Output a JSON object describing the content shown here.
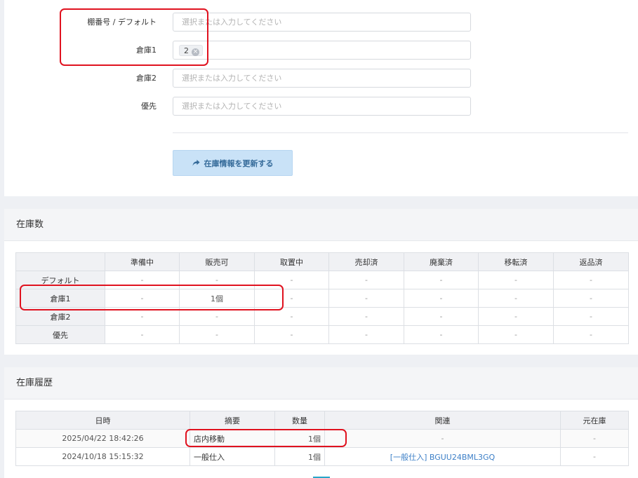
{
  "form": {
    "fields": [
      {
        "label": "棚番号 / デフォルト",
        "placeholder": "選択または入力してください"
      },
      {
        "label": "倉庫1",
        "tag": "2"
      },
      {
        "label": "倉庫2",
        "placeholder": "選択または入力してください"
      },
      {
        "label": "優先",
        "placeholder": "選択または入力してください"
      }
    ],
    "update_button": "在庫情報を更新する",
    "update_icon": "share-arrow-icon"
  },
  "stock": {
    "title": "在庫数",
    "columns": [
      "",
      "準備中",
      "販売可",
      "取置中",
      "売却済",
      "廃棄済",
      "移転済",
      "返品済"
    ],
    "rows": [
      {
        "label": "デフォルト",
        "cells": [
          "-",
          "-",
          "-",
          "-",
          "-",
          "-",
          "-"
        ]
      },
      {
        "label": "倉庫1",
        "cells": [
          "-",
          "1個",
          "-",
          "-",
          "-",
          "-",
          "-"
        ]
      },
      {
        "label": "倉庫2",
        "cells": [
          "-",
          "-",
          "-",
          "-",
          "-",
          "-",
          "-"
        ]
      },
      {
        "label": "優先",
        "cells": [
          "-",
          "-",
          "-",
          "-",
          "-",
          "-",
          "-"
        ]
      }
    ]
  },
  "history": {
    "title": "在庫履歴",
    "columns": [
      "日時",
      "摘要",
      "数量",
      "関連",
      "元在庫"
    ],
    "rows": [
      {
        "datetime": "2025/04/22 18:42:26",
        "summary": "店内移動",
        "qty": "1個",
        "related": "-",
        "source": "-"
      },
      {
        "datetime": "2024/10/18 15:15:32",
        "summary": "一般仕入",
        "qty": "1個",
        "related": "[一般仕入] BGUU24BML3GQ",
        "source": "-"
      }
    ]
  },
  "colors": {
    "annotation": "#e0121f",
    "link": "#3c7fc7",
    "button_bg": "#c9e2f7"
  }
}
